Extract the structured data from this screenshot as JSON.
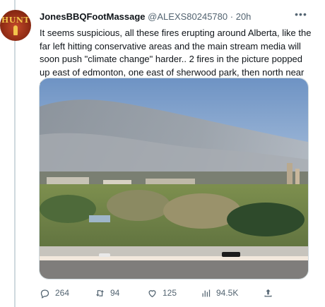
{
  "tweet": {
    "avatar_text": "HUNT",
    "display_name": "JonesBBQFootMassage",
    "handle": "@ALEXS80245780",
    "separator": "·",
    "time": "20h",
    "text": "It seems suspicious, all these fires erupting around Alberta, like the far left hitting conservative areas and the main stream media will soon push \"climate change\" harder.. 2 fires in the picture popped up east of edmonton, one east of sherwood park, then north near fort sask",
    "more_icon": "ellipsis-icon"
  },
  "actions": {
    "reply": {
      "icon": "reply-icon",
      "count": "264"
    },
    "retweet": {
      "icon": "retweet-icon",
      "count": "94"
    },
    "like": {
      "icon": "heart-icon",
      "count": "125"
    },
    "views": {
      "icon": "views-chart-icon",
      "count": "94.5K"
    },
    "share": {
      "icon": "share-icon"
    }
  },
  "colors": {
    "text_primary": "#0f1419",
    "text_secondary": "#536471",
    "border": "#cfd9de"
  }
}
